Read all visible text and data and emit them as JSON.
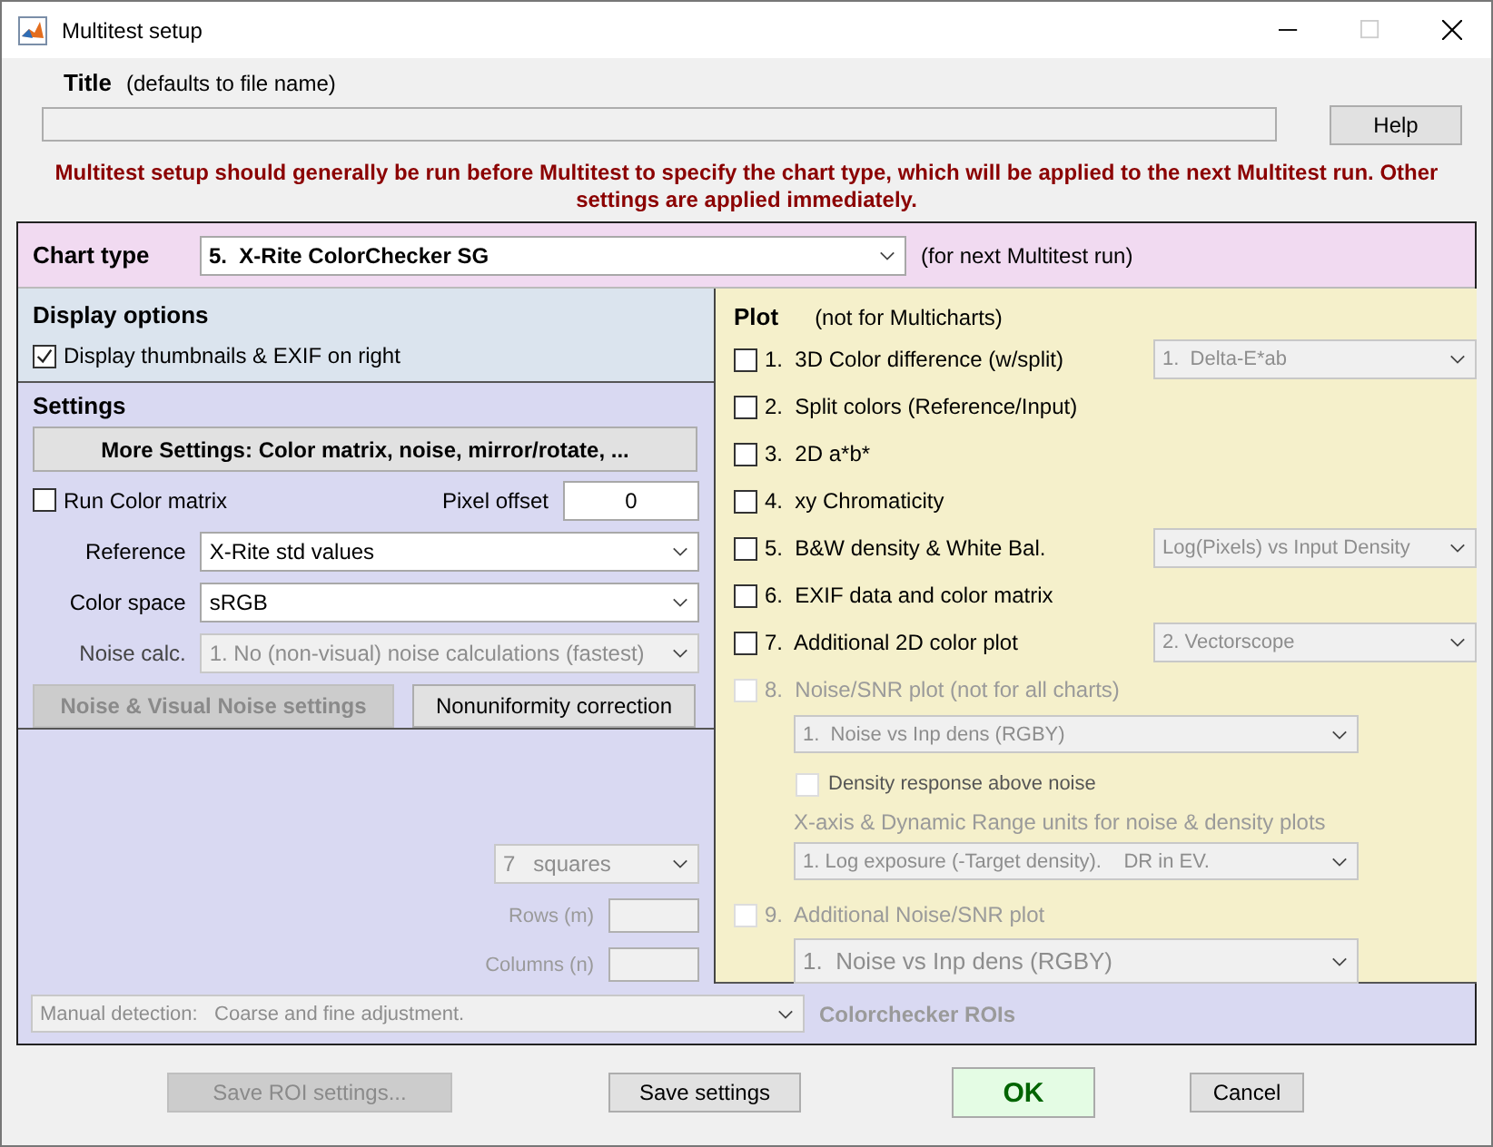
{
  "window": {
    "title": "Multitest setup"
  },
  "title_field": {
    "label": "Title",
    "hint": "(defaults to file name)"
  },
  "help_button": {
    "label": "Help"
  },
  "notice": "Multitest setup should generally be run before Multitest to specify the chart type, which will be applied to the next Multitest run. Other settings are applied immediately.",
  "chart_type": {
    "label": "Chart type",
    "value": "5.  X-Rite ColorChecker SG",
    "note": "(for next Multitest run)"
  },
  "display_options": {
    "heading": "Display options",
    "checkbox": {
      "label": "Display thumbnails & EXIF on right",
      "checked": true
    }
  },
  "settings": {
    "heading": "Settings",
    "more_button": "More Settings:  Color matrix, noise, mirror/rotate, ...",
    "run_color_matrix": {
      "label": "Run Color matrix",
      "checked": false
    },
    "pixel_offset": {
      "label": "Pixel offset",
      "value": "0"
    },
    "selects": [
      {
        "label": "Reference",
        "value": "X-Rite std values",
        "disabled": false
      },
      {
        "label": "Color space",
        "value": "sRGB",
        "disabled": false
      },
      {
        "label": "Noise calc.",
        "value": "1. No (non-visual) noise calculations (fastest)",
        "disabled": true
      }
    ],
    "buttons": [
      {
        "label": "Noise & Visual Noise settings",
        "disabled": true
      },
      {
        "label": "Nonuniformity correction",
        "disabled": false
      }
    ]
  },
  "roi": {
    "squares": {
      "value": "7   squares",
      "disabled": true
    },
    "fields": [
      {
        "label": "Rows (m)",
        "disabled": true
      },
      {
        "label": "Columns (n)",
        "disabled": true
      }
    ],
    "detection": {
      "value": "Manual detection:   Coarse and fine adjustment.",
      "disabled": true
    },
    "label": "Colorchecker ROIs",
    "label_disabled": true
  },
  "plot": {
    "heading": "Plot",
    "note": "(not for Multicharts)",
    "items": [
      {
        "kind": "option",
        "label": "1.  3D Color difference (w/split)",
        "checked": false,
        "disabled": false,
        "select": {
          "value": "1.  Delta-E*ab",
          "disabled": true
        }
      },
      {
        "kind": "option",
        "label": "2.  Split colors (Reference/Input)",
        "checked": false,
        "disabled": false
      },
      {
        "kind": "option",
        "label": "3.  2D a*b*",
        "checked": false,
        "disabled": false
      },
      {
        "kind": "option",
        "label": "4.  xy Chromaticity",
        "checked": false,
        "disabled": false
      },
      {
        "kind": "option",
        "label": "5.  B&W density & White Bal.",
        "checked": false,
        "disabled": false,
        "select": {
          "value": "Log(Pixels) vs Input Density",
          "disabled": true
        }
      },
      {
        "kind": "option",
        "label": "6.  EXIF data and color matrix",
        "checked": false,
        "disabled": false
      },
      {
        "kind": "option",
        "label": "7.  Additional 2D color plot",
        "checked": false,
        "disabled": false,
        "select": {
          "value": "2. Vectorscope",
          "disabled": true
        }
      },
      {
        "kind": "option",
        "label": "8.  Noise/SNR plot (not for all charts)",
        "checked": false,
        "disabled": true
      },
      {
        "kind": "subselect",
        "value": "1.  Noise vs Inp dens (RGBY)",
        "disabled": true
      },
      {
        "kind": "subcheck",
        "label": "Density response above noise",
        "checked": false,
        "disabled": true
      },
      {
        "kind": "caption",
        "label": "X-axis & Dynamic Range units for noise & density plots",
        "disabled": true
      },
      {
        "kind": "subselect",
        "value": "1. Log exposure (-Target density).    DR in EV.",
        "disabled": true
      },
      {
        "kind": "option",
        "label": "9.  Additional Noise/SNR plot",
        "checked": false,
        "disabled": true
      },
      {
        "kind": "bigselect",
        "value": "1.  Noise vs Inp dens (RGBY)",
        "disabled": true
      }
    ]
  },
  "buttons": [
    {
      "kind": "normal",
      "label": "Save ROI settings...",
      "disabled": true
    },
    {
      "kind": "normal",
      "label": "Save settings",
      "disabled": false
    },
    {
      "kind": "primary",
      "label": "OK",
      "disabled": false
    },
    {
      "kind": "normal",
      "label": "Cancel",
      "disabled": false
    }
  ]
}
